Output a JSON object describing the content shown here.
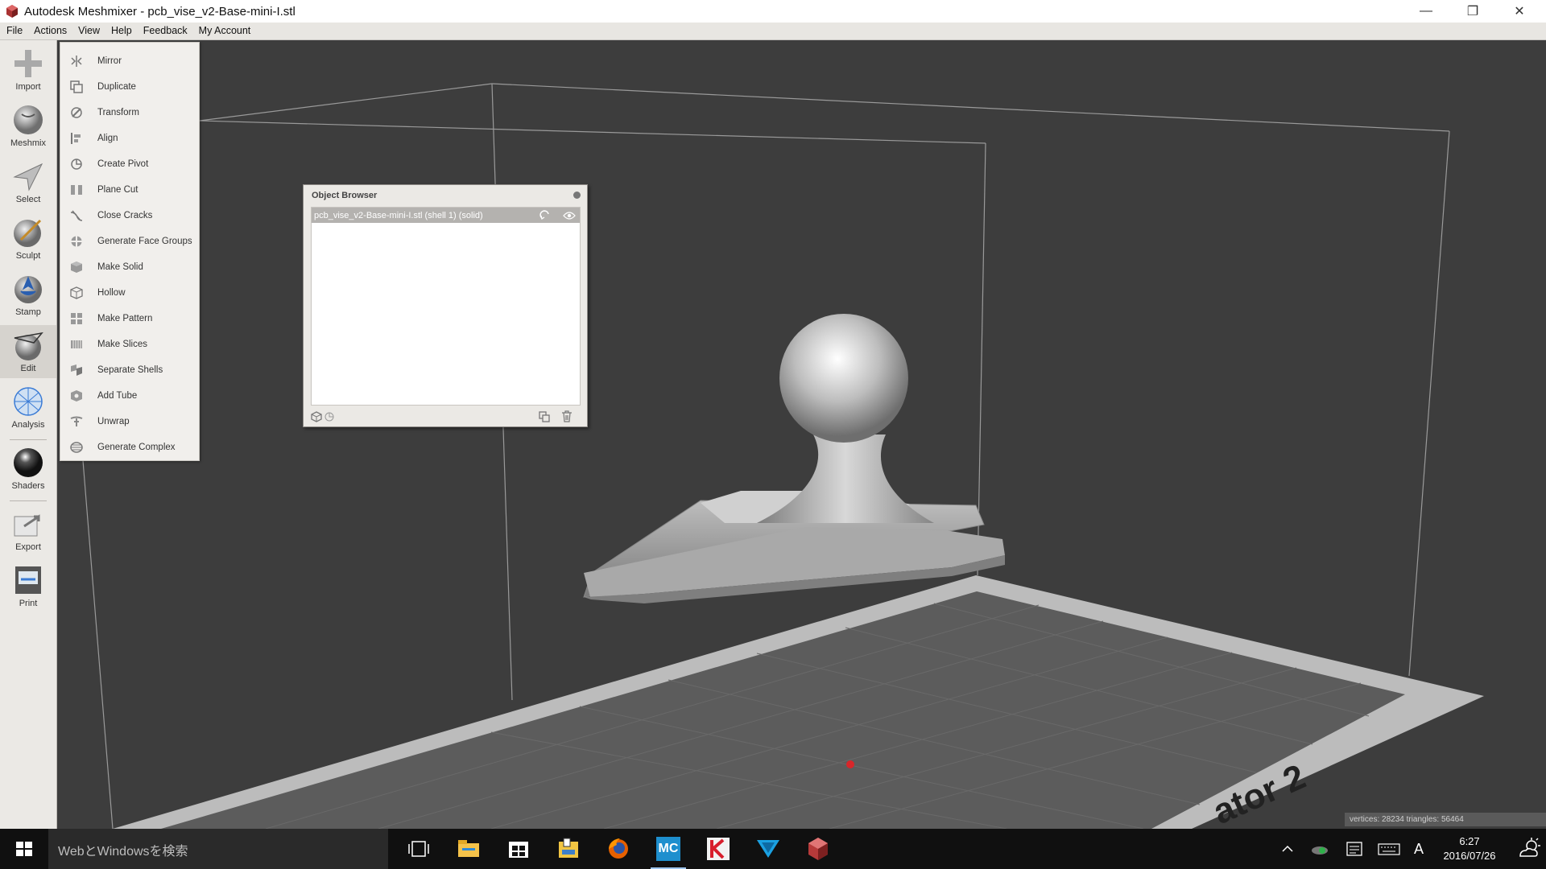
{
  "window": {
    "title": "Autodesk Meshmixer - pcb_vise_v2-Base-mini-I.stl",
    "minimize_glyph": "—",
    "restore_glyph": "❐",
    "close_glyph": "✕"
  },
  "menubar": [
    "File",
    "Actions",
    "View",
    "Help",
    "Feedback",
    "My Account"
  ],
  "tools": [
    {
      "label": "Import",
      "icon": "import-icon"
    },
    {
      "label": "Meshmix",
      "icon": "meshmix-icon"
    },
    {
      "label": "Select",
      "icon": "select-icon"
    },
    {
      "label": "Sculpt",
      "icon": "sculpt-icon"
    },
    {
      "label": "Stamp",
      "icon": "stamp-icon"
    },
    {
      "label": "Edit",
      "icon": "edit-icon",
      "active": true
    },
    {
      "label": "Analysis",
      "icon": "analysis-icon"
    },
    {
      "label": "Shaders",
      "icon": "shaders-icon"
    },
    {
      "label": "Export",
      "icon": "export-icon"
    },
    {
      "label": "Print",
      "icon": "print-icon"
    }
  ],
  "edit_menu": [
    {
      "label": "Mirror",
      "icon": "mirror-icon"
    },
    {
      "label": "Duplicate",
      "icon": "duplicate-icon"
    },
    {
      "label": "Transform",
      "icon": "transform-icon"
    },
    {
      "label": "Align",
      "icon": "align-icon"
    },
    {
      "label": "Create Pivot",
      "icon": "pivot-icon"
    },
    {
      "label": "Plane Cut",
      "icon": "plane-cut-icon"
    },
    {
      "label": "Close Cracks",
      "icon": "close-cracks-icon"
    },
    {
      "label": "Generate Face Groups",
      "icon": "face-groups-icon"
    },
    {
      "label": "Make Solid",
      "icon": "make-solid-icon"
    },
    {
      "label": "Hollow",
      "icon": "hollow-icon"
    },
    {
      "label": "Make Pattern",
      "icon": "pattern-icon"
    },
    {
      "label": "Make Slices",
      "icon": "slices-icon"
    },
    {
      "label": "Separate Shells",
      "icon": "separate-shells-icon"
    },
    {
      "label": "Add Tube",
      "icon": "add-tube-icon"
    },
    {
      "label": "Unwrap",
      "icon": "unwrap-icon"
    },
    {
      "label": "Generate Complex",
      "icon": "complex-icon"
    }
  ],
  "object_browser": {
    "title": "Object Browser",
    "objects": [
      {
        "label": "pcb_vise_v2-Base-mini-I.stl (shell 1) (solid)"
      }
    ]
  },
  "viewport": {
    "build_plate_label": "ator 2",
    "status": "vertices: 28234 triangles: 56464"
  },
  "taskbar": {
    "search_placeholder": "WebとWindowsを検索",
    "ime": "A",
    "time": "6:27",
    "date": "2016/07/26",
    "apps": [
      {
        "name": "task-view-icon"
      },
      {
        "name": "file-explorer-icon"
      },
      {
        "name": "store-icon"
      },
      {
        "name": "folder-icon"
      },
      {
        "name": "firefox-icon"
      },
      {
        "name": "mc-app-icon",
        "label": "MC"
      },
      {
        "name": "k-app-icon"
      },
      {
        "name": "v-app-icon"
      },
      {
        "name": "meshmixer-icon"
      }
    ]
  },
  "colors": {
    "viewport_bg": "#3d3d3d",
    "panel_bg": "#ebe9e5",
    "selection_row": "#b4b2af",
    "taskbar": "#101010"
  }
}
